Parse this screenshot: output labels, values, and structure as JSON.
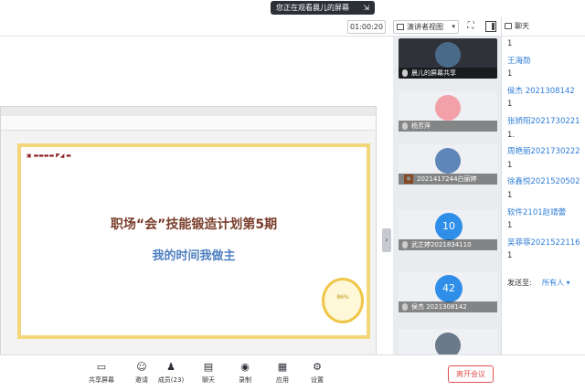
{
  "banner": {
    "text": "您正在观看晨儿的屏幕"
  },
  "toolbar": {
    "timer": "01:00:20",
    "speaker_view": "演讲者视图"
  },
  "slide": {
    "title": "职场“会”技能锻造计划第5期",
    "subtitle": "我的时间我做主",
    "clock_label": "86%"
  },
  "videos": [
    {
      "name": "晨儿的屏幕共享"
    },
    {
      "name": "杨芳萍"
    },
    {
      "name": "2021417244白丽婷"
    },
    {
      "name": "武芷婷2021834110",
      "circle": "10"
    },
    {
      "name": "侯杰 2021308142",
      "circle": "42"
    },
    {
      "name": ""
    }
  ],
  "chat": {
    "header": "聊天",
    "messages": [
      {
        "text": "1",
        "sender": false
      },
      {
        "text": "王海勋",
        "sender": true
      },
      {
        "text": "1",
        "sender": false
      },
      {
        "text": "侯杰 2021308142",
        "sender": true
      },
      {
        "text": "1",
        "sender": false
      },
      {
        "text": "张娇阳2021730221",
        "sender": true
      },
      {
        "text": "1.",
        "sender": false
      },
      {
        "text": "周艳丽2021730222",
        "sender": true
      },
      {
        "text": "1",
        "sender": false
      },
      {
        "text": "徐鑫悦2021520502",
        "sender": true
      },
      {
        "text": "1",
        "sender": false
      },
      {
        "text": "软件2101赵靖蕾",
        "sender": true
      },
      {
        "text": "1",
        "sender": false
      },
      {
        "text": "吴菲菲2021522116",
        "sender": true
      },
      {
        "text": "1",
        "sender": false
      }
    ],
    "send_to_label": "发送至:",
    "send_to_value": "所有人"
  },
  "bottom": {
    "share": "共享屏幕",
    "invite": "邀请",
    "members": "成员(23)",
    "chat": "聊天",
    "record": "录制",
    "apps": "应用",
    "settings": "设置",
    "leave": "离开会议"
  }
}
